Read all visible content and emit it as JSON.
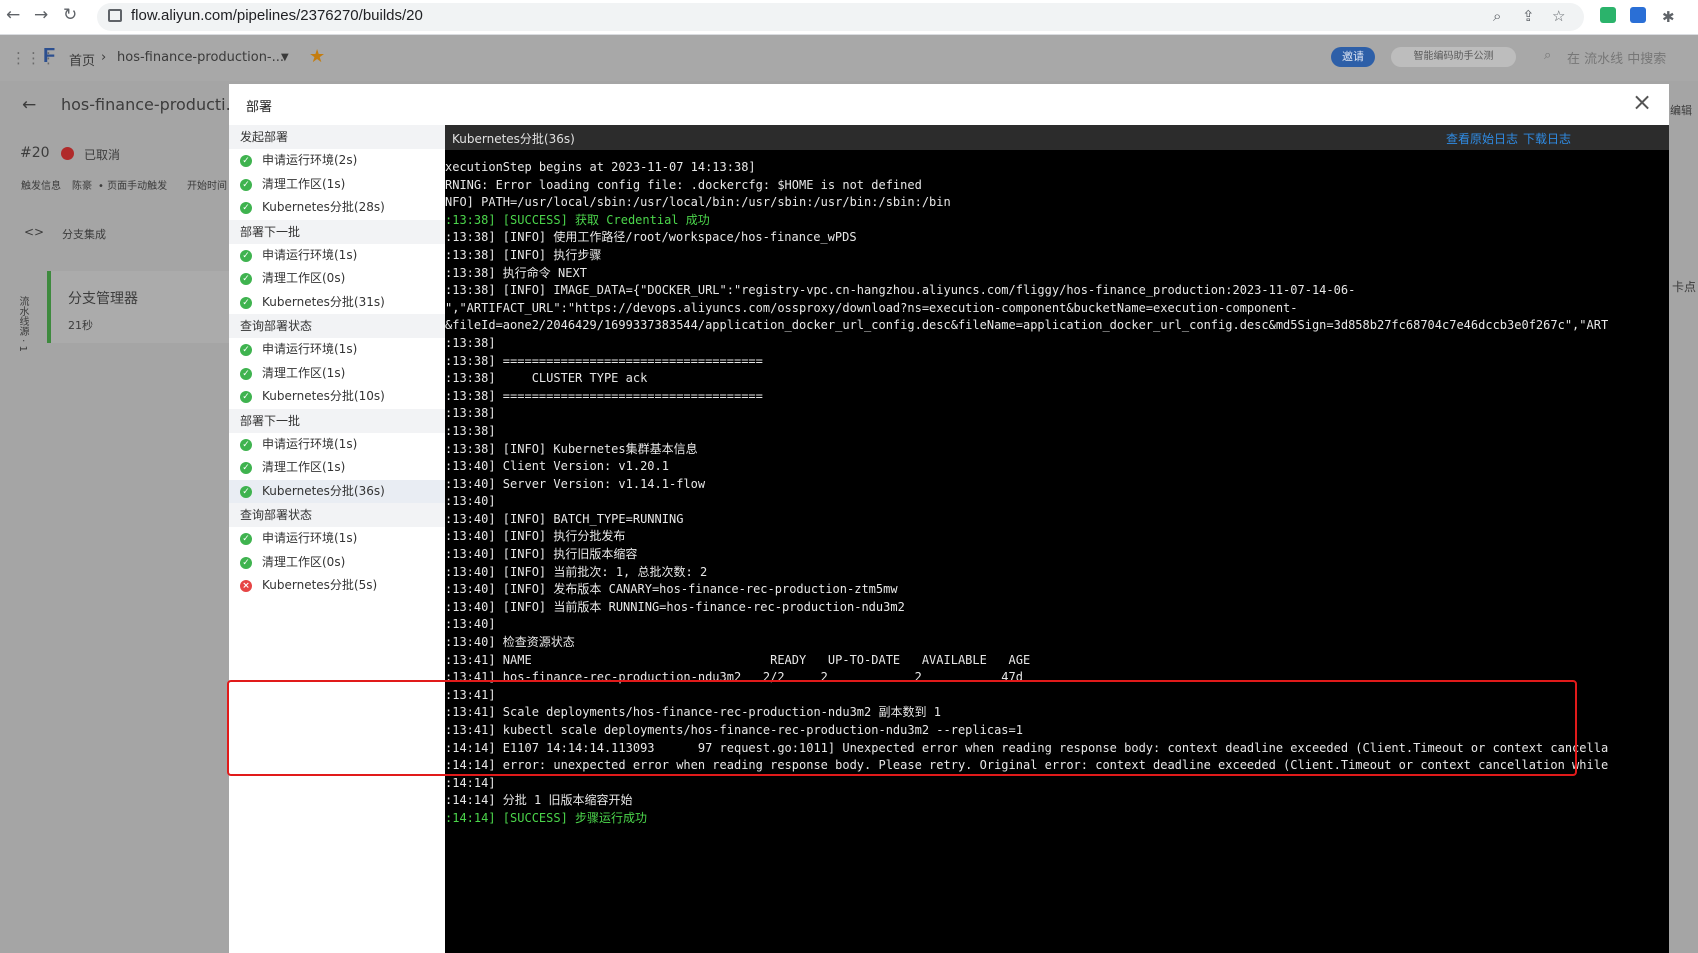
{
  "browser": {
    "url": "flow.aliyun.com/pipelines/2376270/builds/20"
  },
  "app": {
    "breadcrumb_home": "首页",
    "breadcrumb_pipeline": "hos-finance-production-...",
    "invite_label": "邀请",
    "assistant_label": "智能编码助手公测",
    "search_placeholder": "在 流水线 中搜索"
  },
  "page": {
    "pipeline_title": "hos-finance-producti...",
    "build_number": "#20",
    "build_status": "已取消",
    "trigger_label": "触发信息",
    "trigger_user": "陈豪",
    "trigger_method": "• 页面手动触发",
    "start_time_label": "开始时间",
    "source_label": "流水线源 · 1",
    "stage_label": "分支集成",
    "stage_card_title": "分支管理器",
    "stage_card_duration": "21秒",
    "edit_label": "编辑",
    "right_cut_text": "卡点"
  },
  "modal": {
    "title": "部署",
    "groups": [
      {
        "name": "发起部署",
        "steps": [
          {
            "label": "申请运行环境(2s)",
            "status": "success"
          },
          {
            "label": "清理工作区(1s)",
            "status": "success"
          },
          {
            "label": "Kubernetes分批(28s)",
            "status": "success"
          }
        ]
      },
      {
        "name": "部署下一批",
        "steps": [
          {
            "label": "申请运行环境(1s)",
            "status": "success"
          },
          {
            "label": "清理工作区(0s)",
            "status": "success"
          },
          {
            "label": "Kubernetes分批(31s)",
            "status": "success"
          }
        ]
      },
      {
        "name": "查询部署状态",
        "steps": [
          {
            "label": "申请运行环境(1s)",
            "status": "success"
          },
          {
            "label": "清理工作区(1s)",
            "status": "success"
          },
          {
            "label": "Kubernetes分批(10s)",
            "status": "success"
          }
        ]
      },
      {
        "name": "部署下一批",
        "steps": [
          {
            "label": "申请运行环境(1s)",
            "status": "success"
          },
          {
            "label": "清理工作区(1s)",
            "status": "success"
          },
          {
            "label": "Kubernetes分批(36s)",
            "status": "success",
            "active": true
          }
        ]
      },
      {
        "name": "查询部署状态",
        "steps": [
          {
            "label": "申请运行环境(1s)",
            "status": "success"
          },
          {
            "label": "清理工作区(0s)",
            "status": "success"
          },
          {
            "label": "Kubernetes分批(5s)",
            "status": "failed"
          }
        ]
      }
    ],
    "log": {
      "title": "Kubernetes分批(36s)",
      "view_raw_label": "查看原始日志",
      "download_label": "下载日志",
      "lines": [
        {
          "text": "xecutionStep begins at 2023-11-07 14:13:38]",
          "color": "white"
        },
        {
          "text": "RNING: Error loading config file: .dockercfg: $HOME is not defined",
          "color": "white"
        },
        {
          "text": "NFO] PATH=/usr/local/sbin:/usr/local/bin:/usr/sbin:/usr/bin:/sbin:/bin",
          "color": "white"
        },
        {
          "text": ":13:38] [SUCCESS] 获取 Credential 成功",
          "color": "green"
        },
        {
          "text": ":13:38] [INFO] 使用工作路径/root/workspace/hos-finance_wPDS",
          "color": "white"
        },
        {
          "text": ":13:38] [INFO] 执行步骤",
          "color": "white"
        },
        {
          "text": ":13:38] 执行命令 NEXT",
          "color": "white"
        },
        {
          "text": ":13:38] [INFO] IMAGE_DATA={\"DOCKER_URL\":\"registry-vpc.cn-hangzhou.aliyuncs.com/fliggy/hos-finance_production:2023-11-07-14-06-",
          "color": "white"
        },
        {
          "text": "\",\"ARTIFACT_URL\":\"https://devops.aliyuncs.com/ossproxy/download?ns=execution-component&bucketName=execution-component-",
          "color": "white"
        },
        {
          "text": "&fileId=aone2/2046429/1699337383544/application_docker_url_config.desc&fileName=application_docker_url_config.desc&md5Sign=3d858b27fc68704c7e46dccb3e0f267c\",\"ART",
          "color": "white"
        },
        {
          "text": ":13:38]",
          "color": "white"
        },
        {
          "text": ":13:38] ====================================",
          "color": "white"
        },
        {
          "text": ":13:38]     CLUSTER TYPE ack",
          "color": "white"
        },
        {
          "text": ":13:38] ====================================",
          "color": "white"
        },
        {
          "text": ":13:38]",
          "color": "white"
        },
        {
          "text": ":13:38]",
          "color": "white"
        },
        {
          "text": ":13:38] [INFO] Kubernetes集群基本信息",
          "color": "white"
        },
        {
          "text": ":13:40] Client Version: v1.20.1",
          "color": "white"
        },
        {
          "text": ":13:40] Server Version: v1.14.1-flow",
          "color": "white"
        },
        {
          "text": ":13:40]",
          "color": "white"
        },
        {
          "text": ":13:40] [INFO] BATCH_TYPE=RUNNING",
          "color": "white"
        },
        {
          "text": ":13:40] [INFO] 执行分批发布",
          "color": "white"
        },
        {
          "text": ":13:40] [INFO] 执行旧版本缩容",
          "color": "white"
        },
        {
          "text": ":13:40] [INFO] 当前批次: 1, 总批次数: 2",
          "color": "white"
        },
        {
          "text": ":13:40] [INFO] 发布版本 CANARY=hos-finance-rec-production-ztm5mw",
          "color": "white"
        },
        {
          "text": ":13:40] [INFO] 当前版本 RUNNING=hos-finance-rec-production-ndu3m2",
          "color": "white"
        },
        {
          "text": ":13:40]",
          "color": "white"
        },
        {
          "text": ":13:40] 检查资源状态",
          "color": "white"
        },
        {
          "text": ":13:41] NAME                                 READY   UP-TO-DATE   AVAILABLE   AGE",
          "color": "white"
        },
        {
          "text": ":13:41] hos-finance-rec-production-ndu3m2   2/2     2            2           47d",
          "color": "white"
        },
        {
          "text": ":13:41]",
          "color": "white"
        },
        {
          "text": ":13:41] Scale deployments/hos-finance-rec-production-ndu3m2 副本数到 1",
          "color": "white"
        },
        {
          "text": ":13:41] kubectl scale deployments/hos-finance-rec-production-ndu3m2 --replicas=1",
          "color": "white"
        },
        {
          "text": ":14:14] E1107 14:14:14.113093      97 request.go:1011] Unexpected error when reading response body: context deadline exceeded (Client.Timeout or context cancella",
          "color": "white"
        },
        {
          "text": ":14:14] error: unexpected error when reading response body. Please retry. Original error: context deadline exceeded (Client.Timeout or context cancellation while",
          "color": "white"
        },
        {
          "text": ":14:14]",
          "color": "white"
        },
        {
          "text": ":14:14] 分批 1 旧版本缩容开始",
          "color": "white"
        },
        {
          "text": ":14:14] [SUCCESS] 步骤运行成功",
          "color": "green"
        }
      ]
    }
  },
  "colors": {
    "success": "#3fb34f",
    "failed": "#e64545",
    "link": "#2f8be3",
    "log_green": "#4bd54b",
    "highlight_box": "#e11a1a"
  }
}
